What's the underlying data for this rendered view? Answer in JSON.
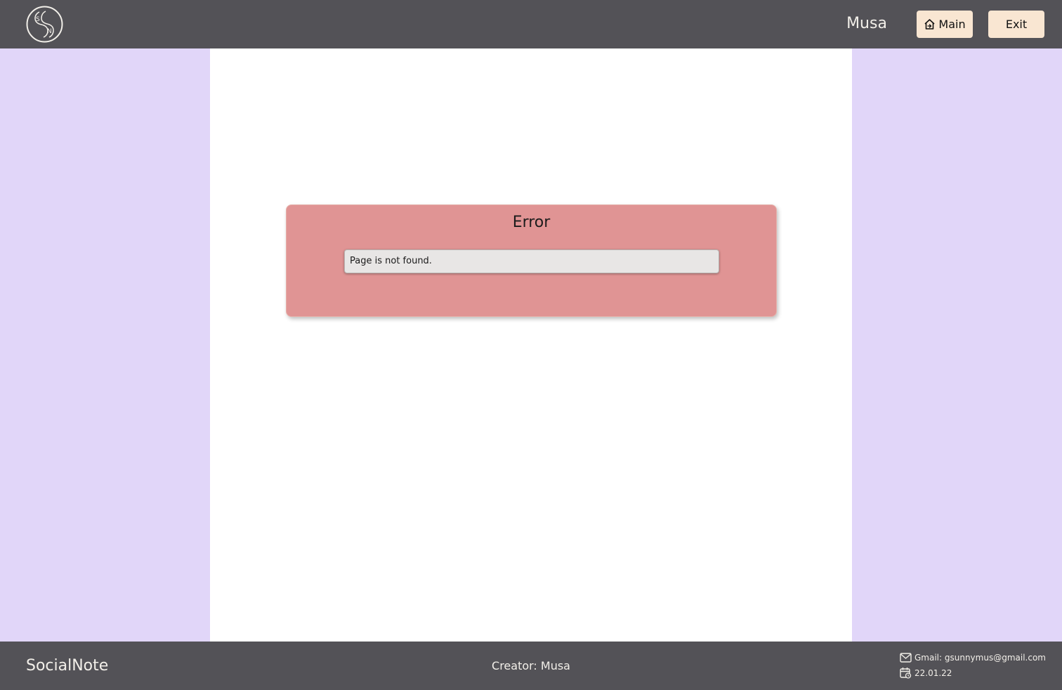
{
  "header": {
    "logo_letters": [
      "S",
      "N"
    ],
    "username": "Musa",
    "main_button": "Main",
    "exit_button": "Exit"
  },
  "error": {
    "title": "Error",
    "message": "Page is not found."
  },
  "footer": {
    "brand": "SocialNote",
    "creator": "Creator: Musa",
    "email": "Gmail: gsunnymus@gmail.com",
    "date": "22.01.22"
  },
  "colors": {
    "header_bg": "#535257",
    "page_bg": "#e1d6f9",
    "content_bg": "#ffffff",
    "button_bg": "#f9e6d2",
    "error_card_bg": "#e09494",
    "error_message_bg": "#e8e6e5"
  },
  "icons": {
    "logo": "socialnote-logo-icon",
    "main": "home-icon",
    "email": "mail-icon",
    "date": "calendar-icon"
  }
}
